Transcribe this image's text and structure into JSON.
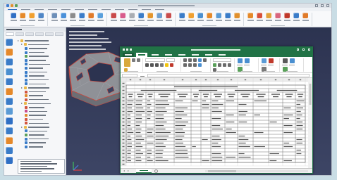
{
  "colors": {
    "frame": "#c9dde5",
    "viewport_top": "#2c3350",
    "viewport_bottom": "#3d4565",
    "model_face": "#8f9197",
    "model_side": "#6c6e75",
    "model_edge": "#c8483e",
    "model_mesh": "#a9abb1",
    "excel_green": "#217346",
    "excel_gridline": "#dadada",
    "excel_table_border": "#666666",
    "excel_header_bg": "#ebebeb"
  },
  "app": {
    "title_icon_colors": [
      "#3b7bd0",
      "#e0902e",
      "#5aa05a"
    ],
    "ribbon_groups": [
      [
        "#2f6fc4",
        "#e5892a",
        "#f0a030",
        "#4f86c6"
      ],
      [
        "#6d8fb8",
        "#4a90d9",
        "#8c8c8c",
        "#3c7dc9",
        "#e07b2a",
        "#5aa0dc"
      ],
      [
        "#c94a4a",
        "#d85b8c",
        "#a9adb3",
        "#3a7cc8",
        "#e4962e",
        "#6f9fd0",
        "#c84c4c"
      ],
      [
        "#3a7cc8",
        "#f0a030",
        "#4a8fd0",
        "#e5892a",
        "#5b9bd5",
        "#3a7cc8",
        "#e0902e"
      ],
      [
        "#e5892a",
        "#d8503a",
        "#e2a23c",
        "#d9667f",
        "#c0392b",
        "#3a7cc8",
        "#e07b2a"
      ]
    ],
    "browser_tool_colors": [
      "#3a7cc8",
      "#e5892a",
      "#3a7cc8",
      "#4a8fd0",
      "#3a7cc8",
      "#e5892a",
      "#3a7cc8",
      "#5b9bd5",
      "#2f6fc4",
      "#3a7cc8",
      "#e5892a",
      "#3a7cc8",
      "#2f6fc4"
    ],
    "tree_items": [
      {
        "icon": "folder-icon",
        "color": "#e8b84a"
      },
      {
        "icon": "folder-icon",
        "color": "#e8b84a"
      },
      {
        "icon": "component-icon",
        "color": "#3a7cc8"
      },
      {
        "icon": "component-icon",
        "color": "#3a7cc8"
      },
      {
        "icon": "component-icon",
        "color": "#5aa05a"
      },
      {
        "icon": "component-icon",
        "color": "#3a7cc8"
      },
      {
        "icon": "component-icon",
        "color": "#3a7cc8"
      },
      {
        "icon": "component-icon",
        "color": "#3a7cc8"
      },
      {
        "icon": "component-icon",
        "color": "#3a7cc8"
      },
      {
        "icon": "component-icon",
        "color": "#3a7cc8"
      },
      {
        "icon": "component-icon",
        "color": "#3a7cc8"
      },
      {
        "icon": "component-icon",
        "color": "#3a7cc8"
      },
      {
        "icon": "folder-icon",
        "color": "#e8b84a"
      },
      {
        "icon": "component-icon",
        "color": "#d2553f"
      },
      {
        "icon": "component-icon",
        "color": "#e08a2e"
      },
      {
        "icon": "component-icon",
        "color": "#d2553f"
      },
      {
        "icon": "folder-icon",
        "color": "#e8b84a"
      },
      {
        "icon": "component-icon",
        "color": "#d2553f"
      },
      {
        "icon": "component-icon",
        "color": "#c94a8c"
      },
      {
        "icon": "component-icon",
        "color": "#e08a2e"
      },
      {
        "icon": "component-icon",
        "color": "#d2553f"
      },
      {
        "icon": "component-icon",
        "color": "#d2553f"
      },
      {
        "icon": "folder-icon",
        "color": "#e8b84a"
      },
      {
        "icon": "component-icon",
        "color": "#3a7cc8"
      },
      {
        "icon": "component-icon",
        "color": "#5aa05a"
      },
      {
        "icon": "component-icon",
        "color": "#3a7cc8"
      },
      {
        "icon": "component-icon",
        "color": "#3a7cc8"
      },
      {
        "icon": "component-icon",
        "color": "#3a7cc8"
      }
    ]
  },
  "excel": {
    "ribbon": {
      "clipboard": [
        {
          "icon": "paste-icon",
          "color": "#d9a93c"
        },
        {
          "icon": "ribbon-icon",
          "color": "#7a7a7a"
        },
        {
          "icon": "ribbon-icon",
          "color": "#7a7a7a"
        },
        {
          "icon": "ribbon-icon",
          "color": "#d9a93c"
        }
      ],
      "font": [
        {
          "icon": "ribbon-icon",
          "color": "#555555"
        },
        {
          "icon": "ribbon-icon",
          "color": "#555555"
        },
        {
          "icon": "ribbon-icon",
          "color": "#555555"
        },
        {
          "icon": "ribbon-icon",
          "color": "#7a7a7a"
        },
        {
          "icon": "ribbon-icon",
          "color": "#f1c40f"
        },
        {
          "icon": "ribbon-icon",
          "color": "#c0392b"
        }
      ],
      "alignment": [
        {
          "icon": "ribbon-icon",
          "color": "#6a6a6a"
        },
        {
          "icon": "ribbon-icon",
          "color": "#6a6a6a"
        },
        {
          "icon": "ribbon-icon",
          "color": "#6a6a6a"
        },
        {
          "icon": "ribbon-icon",
          "color": "#4a8fd0"
        },
        {
          "icon": "ribbon-icon",
          "color": "#6a6a6a"
        },
        {
          "icon": "ribbon-icon",
          "color": "#6a6a6a"
        },
        {
          "icon": "ribbon-icon",
          "color": "#6a6a6a"
        },
        {
          "icon": "ribbon-icon",
          "color": "#6a6a6a"
        },
        {
          "icon": "ribbon-icon",
          "color": "#4a8fd0"
        }
      ],
      "number": [
        {
          "icon": "ribbon-icon",
          "color": "#5aa05a"
        },
        {
          "icon": "ribbon-icon",
          "color": "#6a6a6a"
        },
        {
          "icon": "ribbon-icon",
          "color": "#6a6a6a"
        },
        {
          "icon": "ribbon-icon",
          "color": "#6a6a6a"
        },
        {
          "icon": "ribbon-icon",
          "color": "#6a6a6a"
        }
      ],
      "styles": [
        {
          "icon": "ribbon-icon",
          "color": "#4a8fd0"
        },
        {
          "icon": "ribbon-icon",
          "color": "#4a8fd0"
        },
        {
          "icon": "ribbon-icon",
          "color": "#5aa05a"
        }
      ],
      "cells": [
        {
          "icon": "ribbon-icon",
          "color": "#5b9bd5"
        },
        {
          "icon": "ribbon-icon",
          "color": "#c0392b"
        },
        {
          "icon": "ribbon-icon",
          "color": "#7a7a7a"
        }
      ],
      "editing": [
        {
          "icon": "ribbon-icon",
          "color": "#5a5a5a"
        },
        {
          "icon": "ribbon-icon",
          "color": "#4a8fd0"
        },
        {
          "icon": "ribbon-icon",
          "color": "#5aa05a"
        }
      ]
    }
  }
}
